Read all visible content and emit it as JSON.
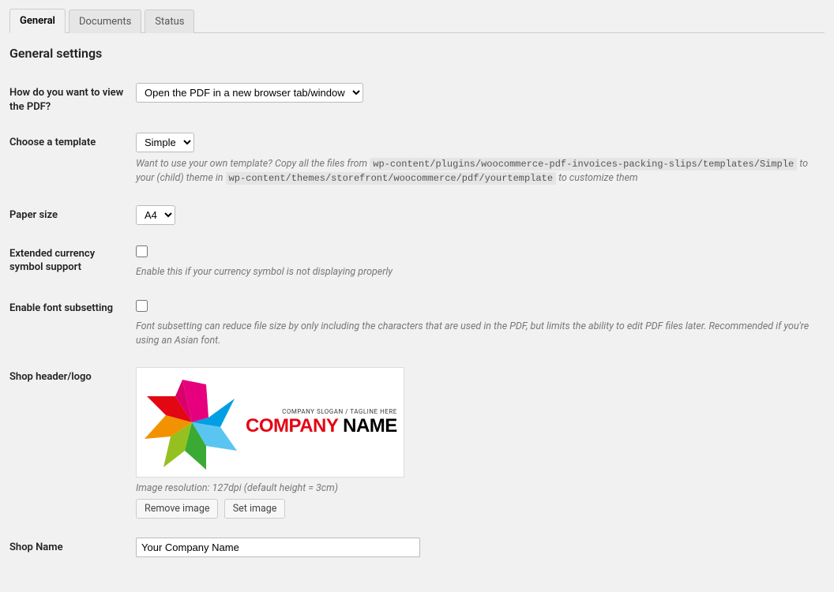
{
  "tabs": [
    {
      "label": "General",
      "active": true
    },
    {
      "label": "Documents",
      "active": false
    },
    {
      "label": "Status",
      "active": false
    }
  ],
  "section_title": "General settings",
  "rows": {
    "view_pdf": {
      "label": "How do you want to view the PDF?",
      "value": "Open the PDF in a new browser tab/window"
    },
    "template": {
      "label": "Choose a template",
      "value": "Simple",
      "help_prefix": "Want to use your own template? Copy all the files from ",
      "code1": "wp-content/plugins/woocommerce-pdf-invoices-packing-slips/templates/Simple",
      "help_mid": " to your (child) theme in ",
      "code2": "wp-content/themes/storefront/woocommerce/pdf/yourtemplate",
      "help_suffix": " to customize them"
    },
    "paper_size": {
      "label": "Paper size",
      "value": "A4"
    },
    "currency": {
      "label": "Extended currency symbol support",
      "checked": false,
      "help": "Enable this if your currency symbol is not displaying properly"
    },
    "font_subset": {
      "label": "Enable font subsetting",
      "checked": false,
      "help": "Font subsetting can reduce file size by only including the characters that are used in the PDF, but limits the ability to edit PDF files later. Recommended if you're using an Asian font."
    },
    "header_logo": {
      "label": "Shop header/logo",
      "logo_slogan": "COMPANY SLOGAN / TAGLINE HERE",
      "logo_word1": "COMPANY",
      "logo_word2": " NAME",
      "resolution_note": "Image resolution: 127dpi (default height = 3cm)",
      "remove_btn": "Remove image",
      "set_btn": "Set image"
    },
    "shop_name": {
      "label": "Shop Name",
      "value": "Your Company Name"
    }
  }
}
